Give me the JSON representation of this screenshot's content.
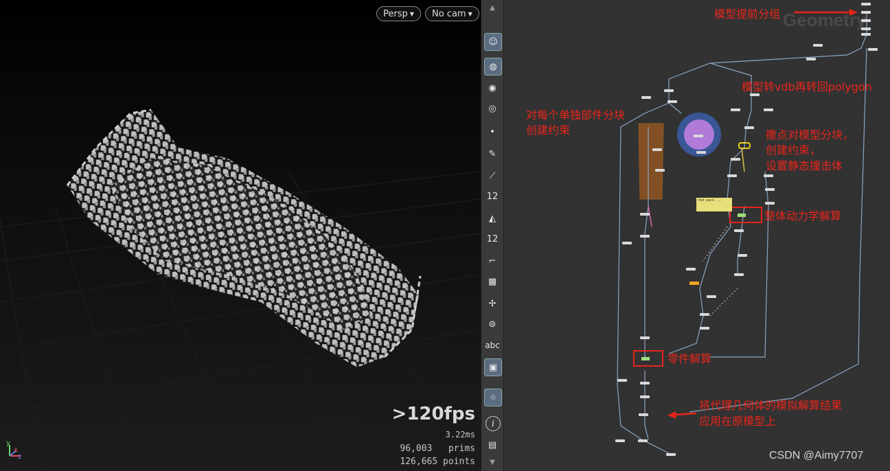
{
  "viewport": {
    "camera_view": "Persp",
    "camera": "No cam",
    "fps": ">120fps",
    "frame_time": "3.22ms",
    "prims_count": "96,003",
    "prims_label": "prims",
    "points_count": "126,665",
    "points_label": "points",
    "axis_labels": {
      "y": "y",
      "x": "x",
      "z": "z"
    }
  },
  "shelf": {
    "tools": [
      {
        "icon": "handle-icon"
      },
      {
        "icon": "checker-sphere-icon"
      },
      {
        "icon": "eye-icon"
      },
      {
        "icon": "camera-eye-icon"
      },
      {
        "icon": "dot-icon"
      },
      {
        "icon": "brush-icon"
      },
      {
        "icon": "pin-icon"
      },
      {
        "icon": "number-icon",
        "label": "12"
      },
      {
        "icon": "paint-icon"
      },
      {
        "icon": "number-paint-icon",
        "label": "12"
      },
      {
        "icon": "curve-icon"
      },
      {
        "icon": "checker-icon"
      },
      {
        "icon": "transform-icon"
      },
      {
        "icon": "circle-slider-icon"
      },
      {
        "icon": "text-icon",
        "label": "abc"
      },
      {
        "icon": "image-icon"
      },
      {
        "icon": "map-pin-icon"
      },
      {
        "icon": "info-icon",
        "label": "i"
      },
      {
        "icon": "grid-icon"
      }
    ]
  },
  "network": {
    "watermark": "Geometry",
    "annotations": {
      "pre_group": "模型提前分组",
      "vdb_polygon": "模型转vdb再转回polygon",
      "per_part_1": "对每个单独部件分块",
      "per_part_2": "创建约束",
      "scatter_1": "撒点对模型分块，",
      "scatter_2": "创建约束，",
      "scatter_3": "设置静态撞击体",
      "whole_solve": "整体动力学解算",
      "part_solve": "零件解算",
      "apply_1": "将代理几何体的模拟解算结果",
      "apply_2": "应用在原模型上"
    },
    "sticky_note": "rbd pack ...",
    "credit": "CSDN @Aimy7707",
    "colors": {
      "annotation": "#e8251a",
      "node": "#d9d9d9",
      "wire": "#8aa7c7",
      "solver_node": "#9ce07c",
      "orange_box": "#c46a1a",
      "blue_circle": "#3a5aa0",
      "purple_circle": "#b07ad8"
    }
  }
}
